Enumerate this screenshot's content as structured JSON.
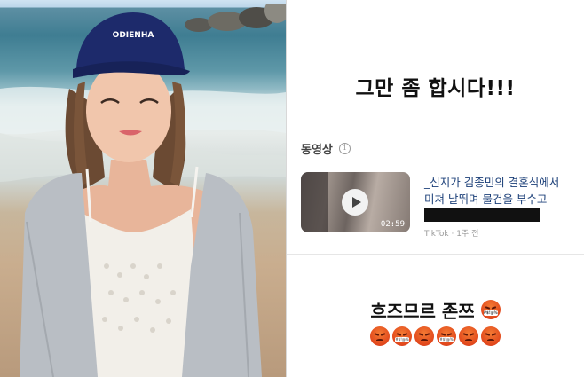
{
  "story": {
    "headline": "그만 좀 합시다!!!",
    "section_label": "동영상",
    "video": {
      "title": "_신지가 김종민의 결혼식에서 미쳐 날뛰며 물건을 부수고 크...",
      "duration": "02:59",
      "meta": "TikTok · 1주 전"
    },
    "reaction_text": "흐즈므르 존쯔",
    "emoji_row": [
      "angry-face",
      "angry-censored-face",
      "angry-face",
      "angry-censored-face",
      "angry-face",
      "angry-face"
    ],
    "emoji_censor_text": "#$!@%"
  },
  "photo": {
    "cap_text": "ODIENHA"
  },
  "colors": {
    "link": "#1b3f78",
    "cap": "#1d2a6b",
    "angry": "#e2481c"
  }
}
